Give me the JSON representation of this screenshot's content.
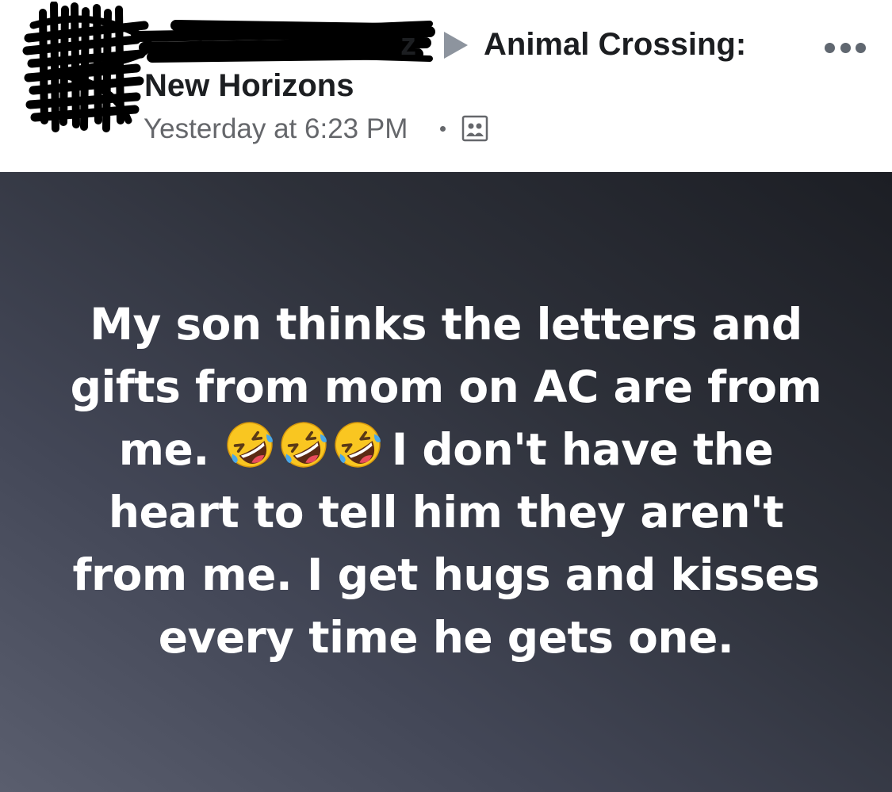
{
  "header": {
    "author_suffix": "z",
    "group_name_line1": "Animal Crossing:",
    "group_name_line2": "New Horizons",
    "timestamp": "Yesterday at 6:23 PM"
  },
  "icons": {
    "share_arrow": "triangle-right-icon",
    "audience": "group-members-icon",
    "more": "ellipsis-icon",
    "emoji": "rolling-on-floor-laughing-icon"
  },
  "post": {
    "line1": "My son thinks the letters and",
    "line2": "gifts from mom on AC are from",
    "line3_start": "me.",
    "line3_end": "I don't have the",
    "line4": "heart to tell him they aren't",
    "line5": "from me. I get hugs and kisses",
    "line6": "every time he gets one."
  },
  "colors": {
    "primary_text": "#1c1e21",
    "secondary_text": "#65676b",
    "post_background_dark": "#1c1e24",
    "post_background_light": "#5a5e6e",
    "post_text": "#ffffff"
  }
}
